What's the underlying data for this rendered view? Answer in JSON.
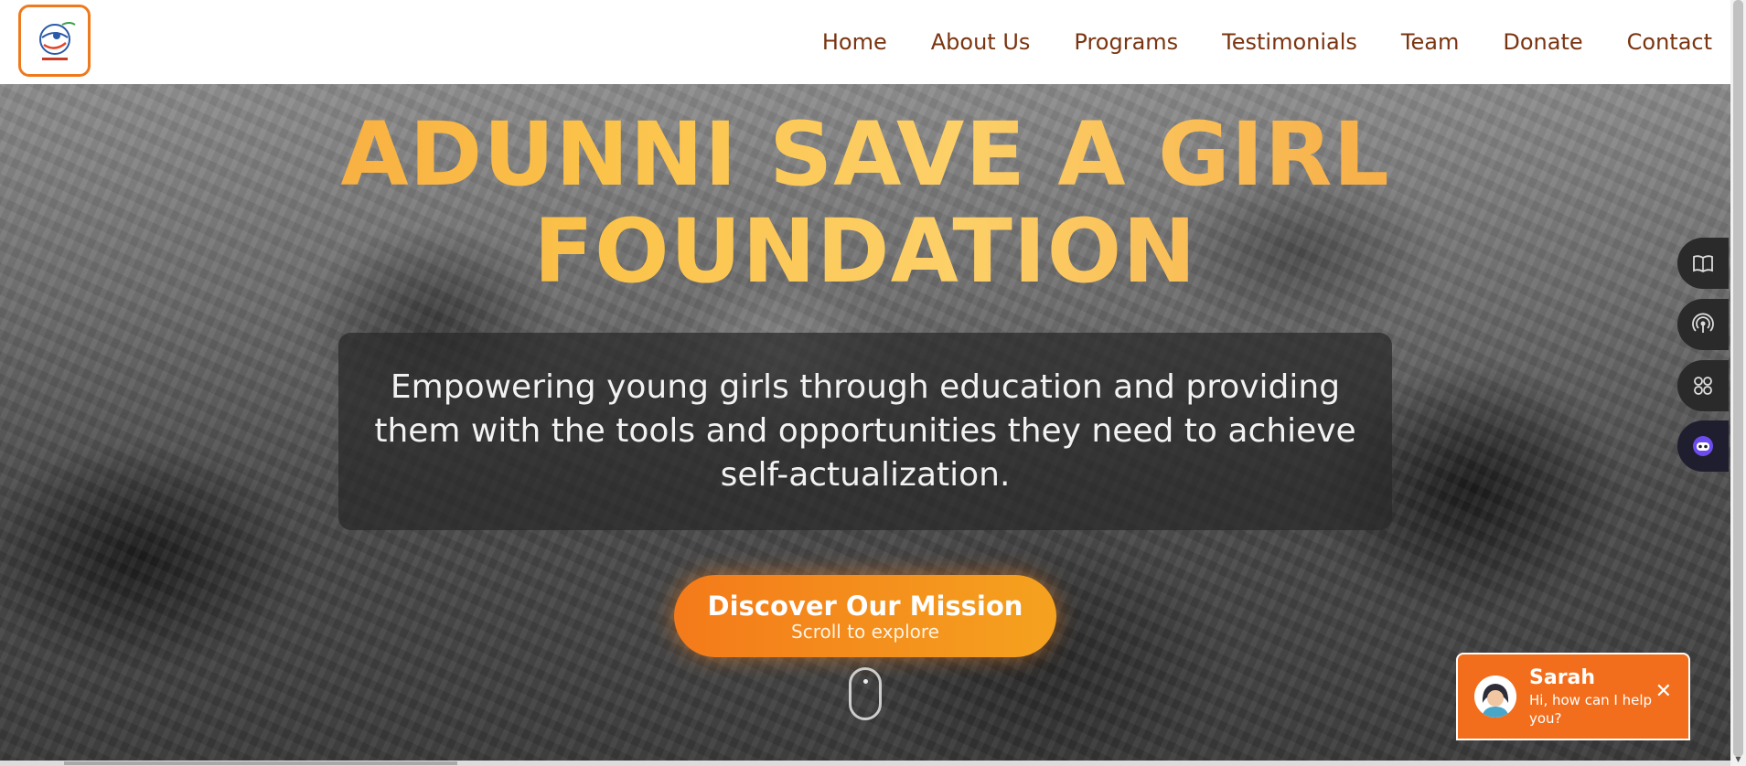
{
  "nav": {
    "links": [
      {
        "label": "Home"
      },
      {
        "label": "About Us"
      },
      {
        "label": "Programs"
      },
      {
        "label": "Testimonials"
      },
      {
        "label": "Team"
      },
      {
        "label": "Donate"
      },
      {
        "label": "Contact"
      }
    ]
  },
  "hero": {
    "title_line1": "ADUNNI SAVE A GIRL",
    "title_line2": "FOUNDATION",
    "tagline": "Empowering young girls through education and providing them with the tools and opportunities they need to achieve self-actualization.",
    "cta_label": "Discover Our Mission",
    "cta_sub": "Scroll to explore"
  },
  "side_tools": [
    {
      "icon": "book-icon"
    },
    {
      "icon": "broadcast-icon"
    },
    {
      "icon": "apps-icon"
    },
    {
      "icon": "assistant-bot-icon"
    }
  ],
  "chat": {
    "name": "Sarah",
    "message": "Hi, how can I help you?",
    "close_symbol": "✕"
  },
  "colors": {
    "accent": "#f26e1c",
    "nav_text": "#7a3410",
    "title_gradient_start": "#f59a3a",
    "title_gradient_mid": "#fdd068"
  }
}
